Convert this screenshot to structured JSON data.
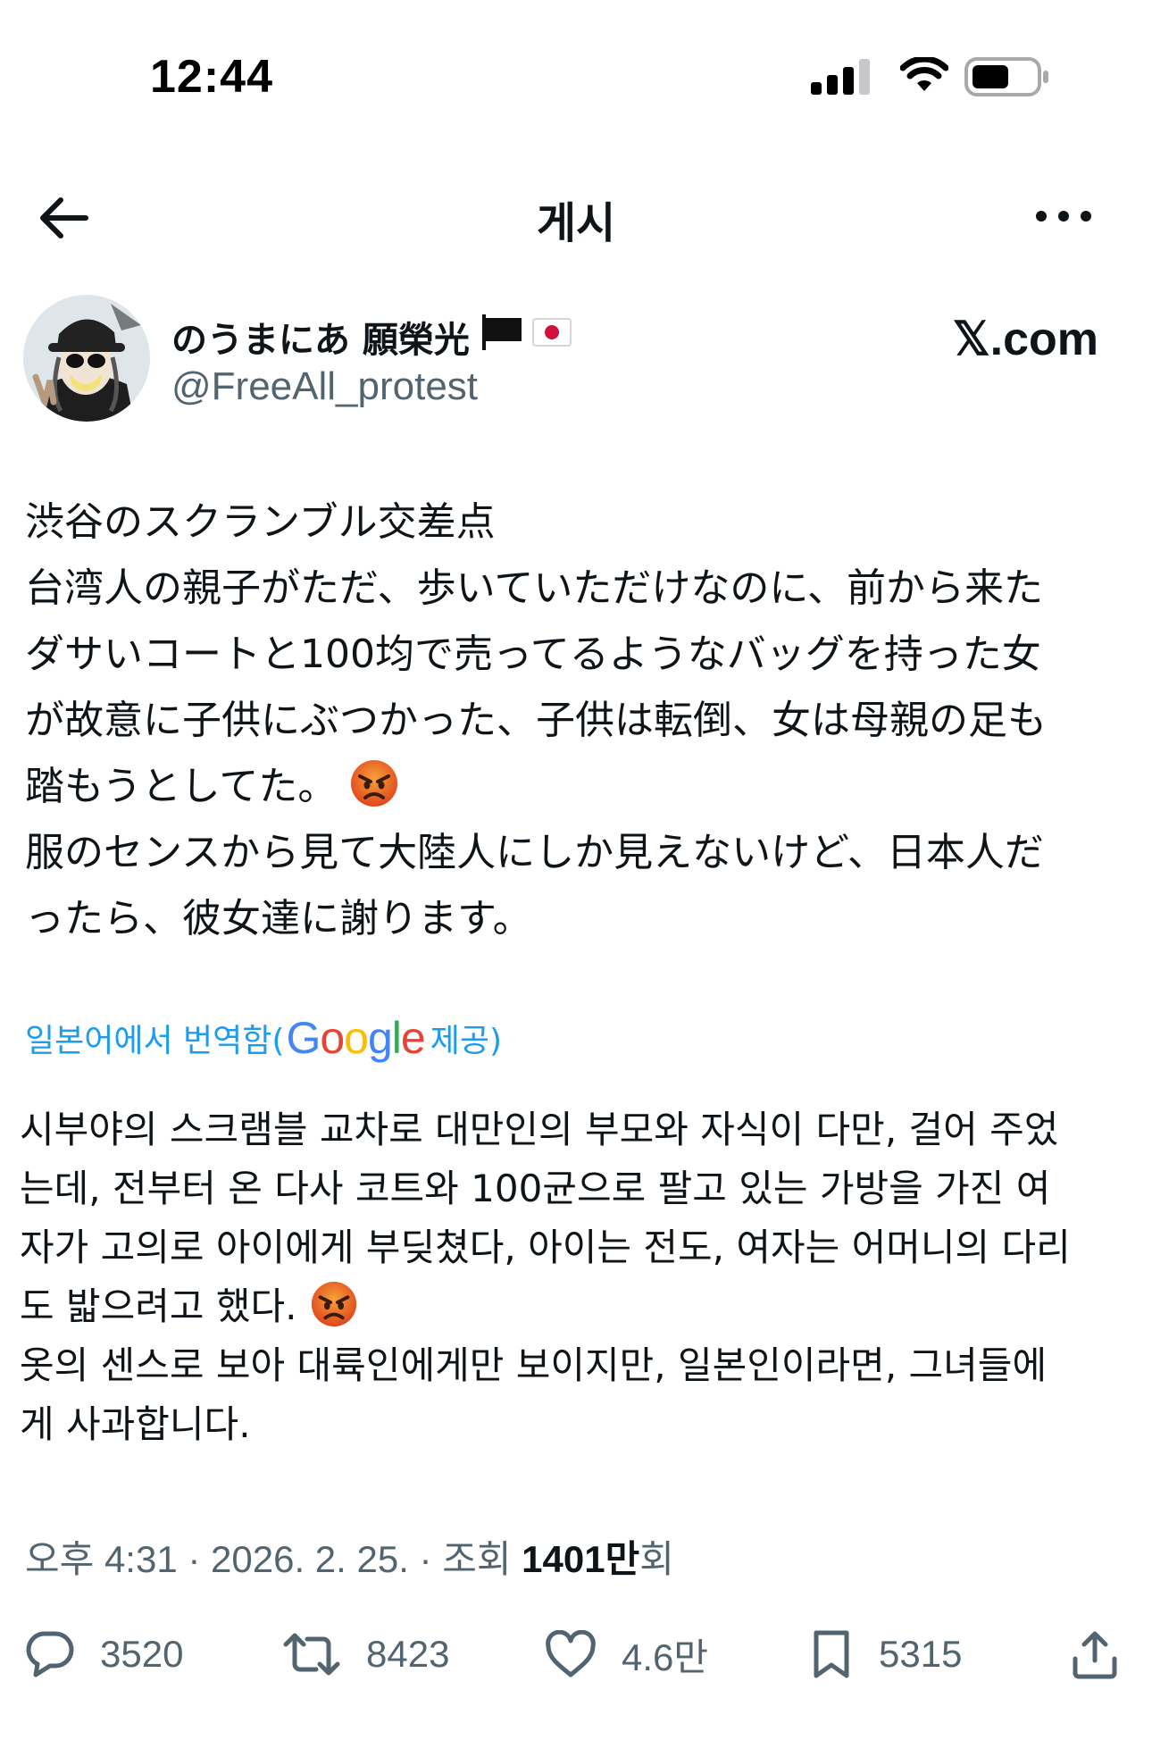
{
  "status_bar": {
    "time": "12:44",
    "icons": [
      "signal-icon",
      "wifi-icon",
      "battery-icon"
    ]
  },
  "header": {
    "title": "게시",
    "back_icon": "back-arrow-icon",
    "more_icon": "more-dots-icon"
  },
  "author": {
    "display_name": "のうまにあ 願榮光",
    "badges": [
      "black-flag-icon",
      "japan-flag-icon"
    ],
    "handle": "@FreeAll_protest",
    "site_logo": "𝕏.com"
  },
  "post": {
    "original_lines": [
      "渋谷のスクランブル交差点",
      "台湾人の親子がただ、歩いていただけなのに、前から来た",
      "ダサいコートと100均で売ってるようなバッグを持った女",
      "が故意に子供にぶつかった、子供は転倒、女は母親の足も",
      "踏もうとしてた。",
      "服のセンスから見て大陸人にしか見えないけど、日本人だ",
      "ったら、彼女達に謝ります。"
    ],
    "translation_prefix": "일본어에서 번역함(",
    "translation_provider": "Google",
    "translation_suffix": " 제공)",
    "translated_lines": [
      "시부야의 스크램블 교차로 대만인의 부모와 자식이 다만, 걸어 주었",
      "는데, 전부터 온 다사 코트와 100균으로 팔고 있는 가방을 가진 여",
      "자가 고의로 아이에게 부딪쳤다, 아이는 전도, 여자는 어머니의 다리",
      "도 밟으려고 했다.",
      "옷의 센스로 보아 대륙인에게만 보이지만, 일본인이라면, 그녀들에",
      "게 사과합니다."
    ],
    "emoji": "angry-face-icon"
  },
  "meta": {
    "time": "오후 4:31",
    "separator": " · ",
    "date": "2026. 2. 25.",
    "views_label": "조회 ",
    "views_count": "1401만",
    "views_suffix": "회"
  },
  "actions": {
    "reply_count": "3520",
    "repost_count": "8423",
    "like_count": "4.6만",
    "bookmark_count": "5315"
  },
  "colors": {
    "text": "#0f1419",
    "secondary": "#536471",
    "link": "#1d9bf0",
    "angry_emoji": "#e85a1b"
  }
}
